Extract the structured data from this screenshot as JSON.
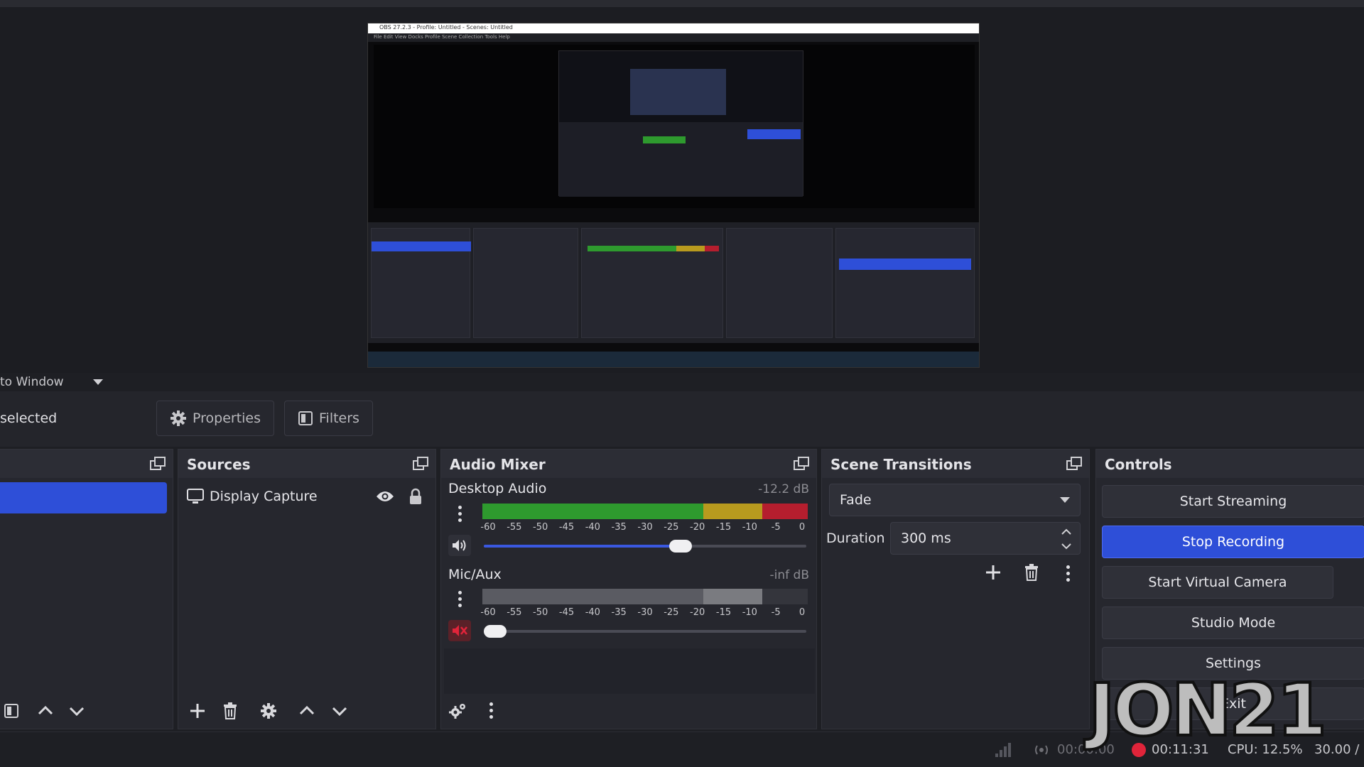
{
  "preview": {
    "nested_title": "OBS 27.2.3 - Profile: Untitled - Scenes: Untitled",
    "nested_menu": "File   Edit   View   Docks   Profile   Scene Collection   Tools   Help"
  },
  "scale": {
    "label": "to Window"
  },
  "context": {
    "selected_text": "selected",
    "properties_label": "Properties",
    "filters_label": "Filters"
  },
  "scenes_dock": {
    "title": ""
  },
  "sources_dock": {
    "title": "Sources",
    "items": [
      {
        "label": "Display Capture"
      }
    ]
  },
  "audio_mixer": {
    "title": "Audio Mixer",
    "channels": [
      {
        "name": "Desktop Audio",
        "db": "-12.2 dB",
        "volume": 0.61,
        "muted": false
      },
      {
        "name": "Mic/Aux",
        "db": "-inf dB",
        "volume": 0.0,
        "muted": true
      }
    ],
    "ticks": [
      "-60",
      "-55",
      "-50",
      "-45",
      "-40",
      "-35",
      "-30",
      "-25",
      "-20",
      "-15",
      "-10",
      "-5",
      "0"
    ]
  },
  "transitions": {
    "title": "Scene Transitions",
    "selected": "Fade",
    "duration_label": "Duration",
    "duration_value": "300 ms"
  },
  "controls": {
    "title": "Controls",
    "start_streaming": "Start Streaming",
    "stop_recording": "Stop Recording",
    "start_virtual_camera": "Start Virtual Camera",
    "studio_mode": "Studio Mode",
    "settings": "Settings",
    "exit": "Exit"
  },
  "status": {
    "stream_time": "00:00:00",
    "rec_time": "00:11:31",
    "cpu": "CPU: 12.5%",
    "fps": "30.00 /"
  },
  "watermark": {
    "text": "JON21"
  },
  "colors": {
    "accent": "#2e4fd8",
    "meter_green": "#2e9a2e",
    "meter_yellow": "#b89a1e",
    "meter_red": "#b51e2e",
    "record": "#e0243a"
  }
}
